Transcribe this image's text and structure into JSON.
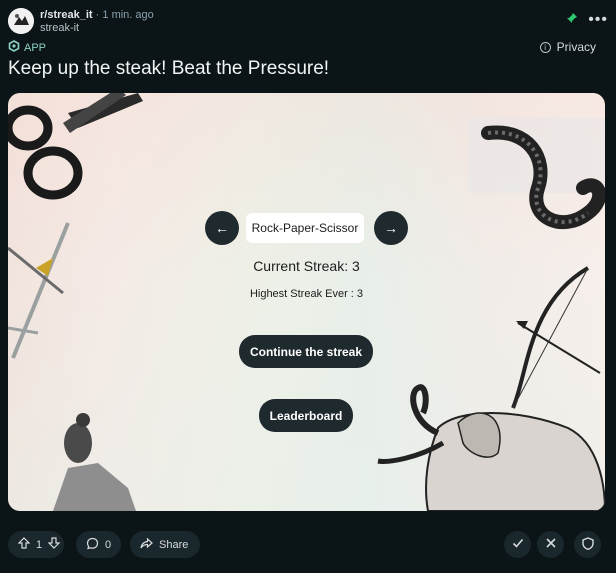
{
  "post": {
    "subreddit": "r/streak_it",
    "separator": "·",
    "time": "1 min. ago",
    "username": "streak-it",
    "badge": "APP",
    "privacy": "Privacy",
    "title": "Keep up the steak! Beat the Pressure!"
  },
  "game": {
    "selected_game": "Rock-Paper-Scissor",
    "current_streak": "Current Streak: 3",
    "highest_streak": "Highest Streak Ever : 3",
    "continue_label": "Continue the streak",
    "leaderboard_label": "Leaderboard",
    "prev_arrow": "←",
    "next_arrow": "→"
  },
  "footer": {
    "vote_count": "1",
    "comment_count": "0",
    "share_label": "Share"
  },
  "colors": {
    "background": "#0b1416",
    "button_dark": "#1f2a2f",
    "app_badge": "#8dd3c7",
    "pin": "#2ecc71"
  }
}
